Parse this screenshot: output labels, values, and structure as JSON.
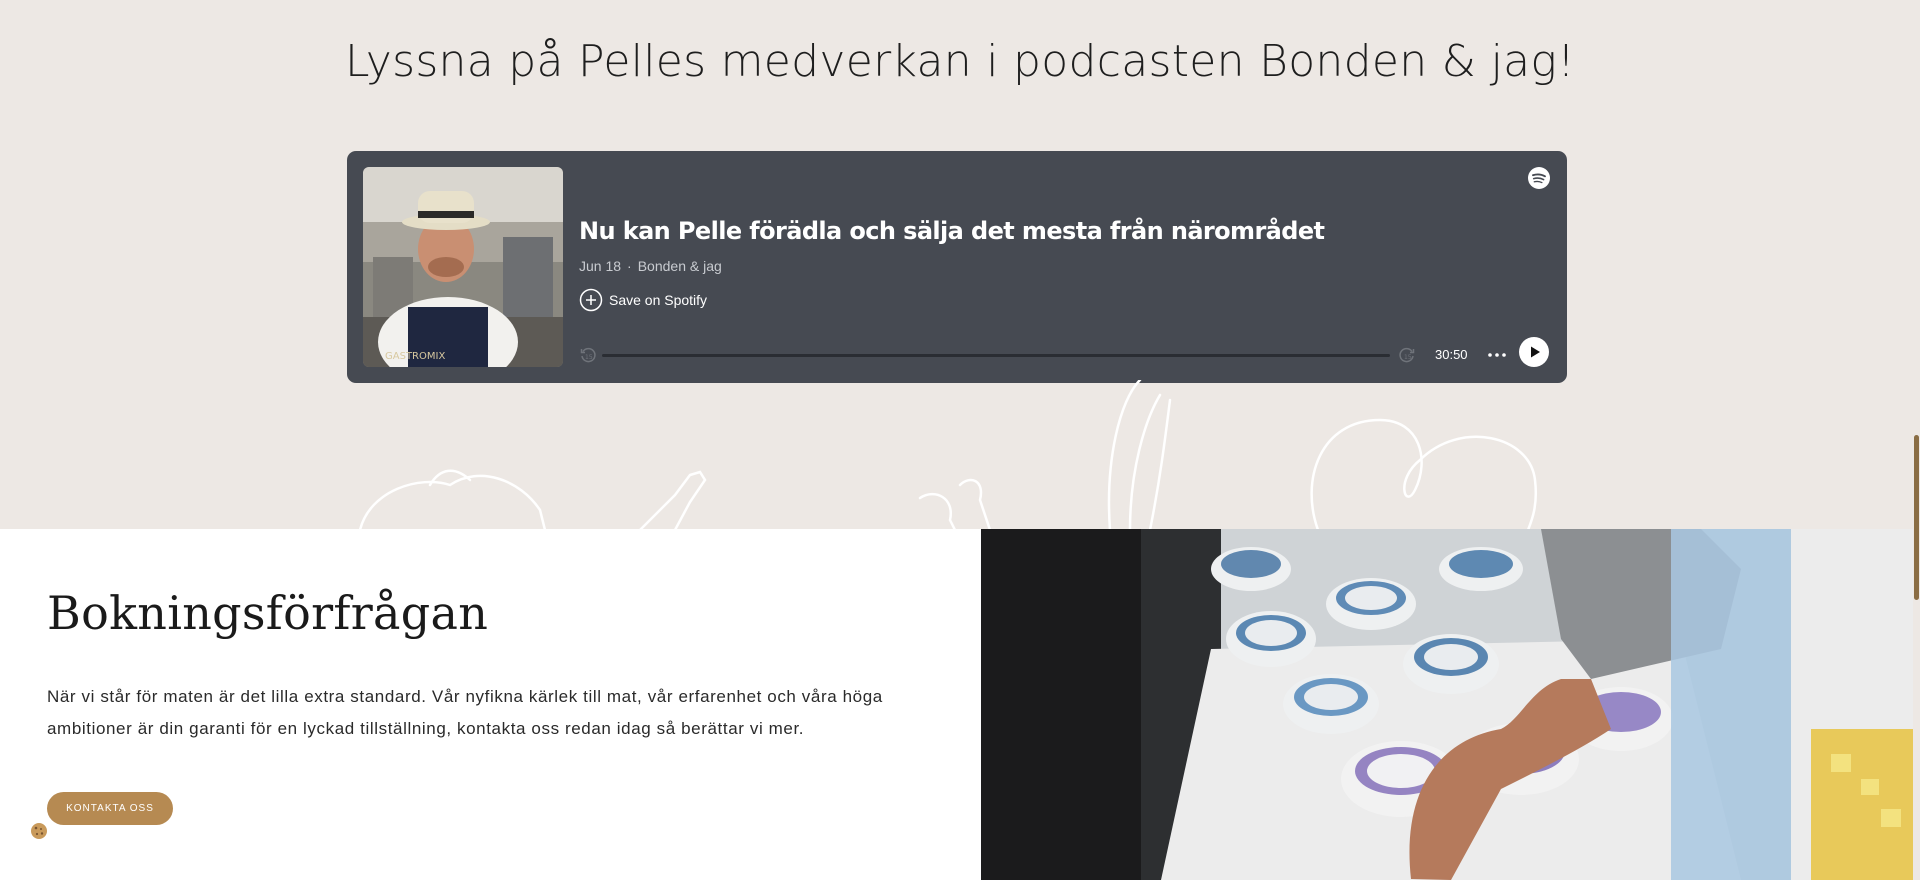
{
  "podcast_section": {
    "heading": "Lyssna på Pelles medverkan i podcasten Bonden & jag!"
  },
  "player": {
    "episode_title": "Nu kan Pelle förädla och sälja det mesta från närområdet",
    "date": "Jun 18",
    "separator": "·",
    "show": "Bonden & jag",
    "save_label": "Save on Spotify",
    "duration": "30:50",
    "progress": 0,
    "cover_apron_text": "GASTROMIX"
  },
  "booking": {
    "title": "Bokningsförfrågan",
    "text": "När vi står för maten är det lilla extra standard. Vår nyfikna kärlek till mat, vår erfarenhet och våra höga ambitioner är din garanti för en lyckad tillställning, kontakta oss redan idag så berättar vi mer.",
    "cta_label": "KONTAKTA OSS"
  },
  "icons": [
    "spotify-icon",
    "add-circle-icon",
    "skip-back-15-icon",
    "skip-forward-15-icon",
    "more-dots-icon",
    "play-icon",
    "cookie-icon"
  ],
  "colors": {
    "page_bg": "#ede8e4",
    "player_bg": "#464a52",
    "accent": "#b68a52",
    "text": "#1e1e1e"
  }
}
